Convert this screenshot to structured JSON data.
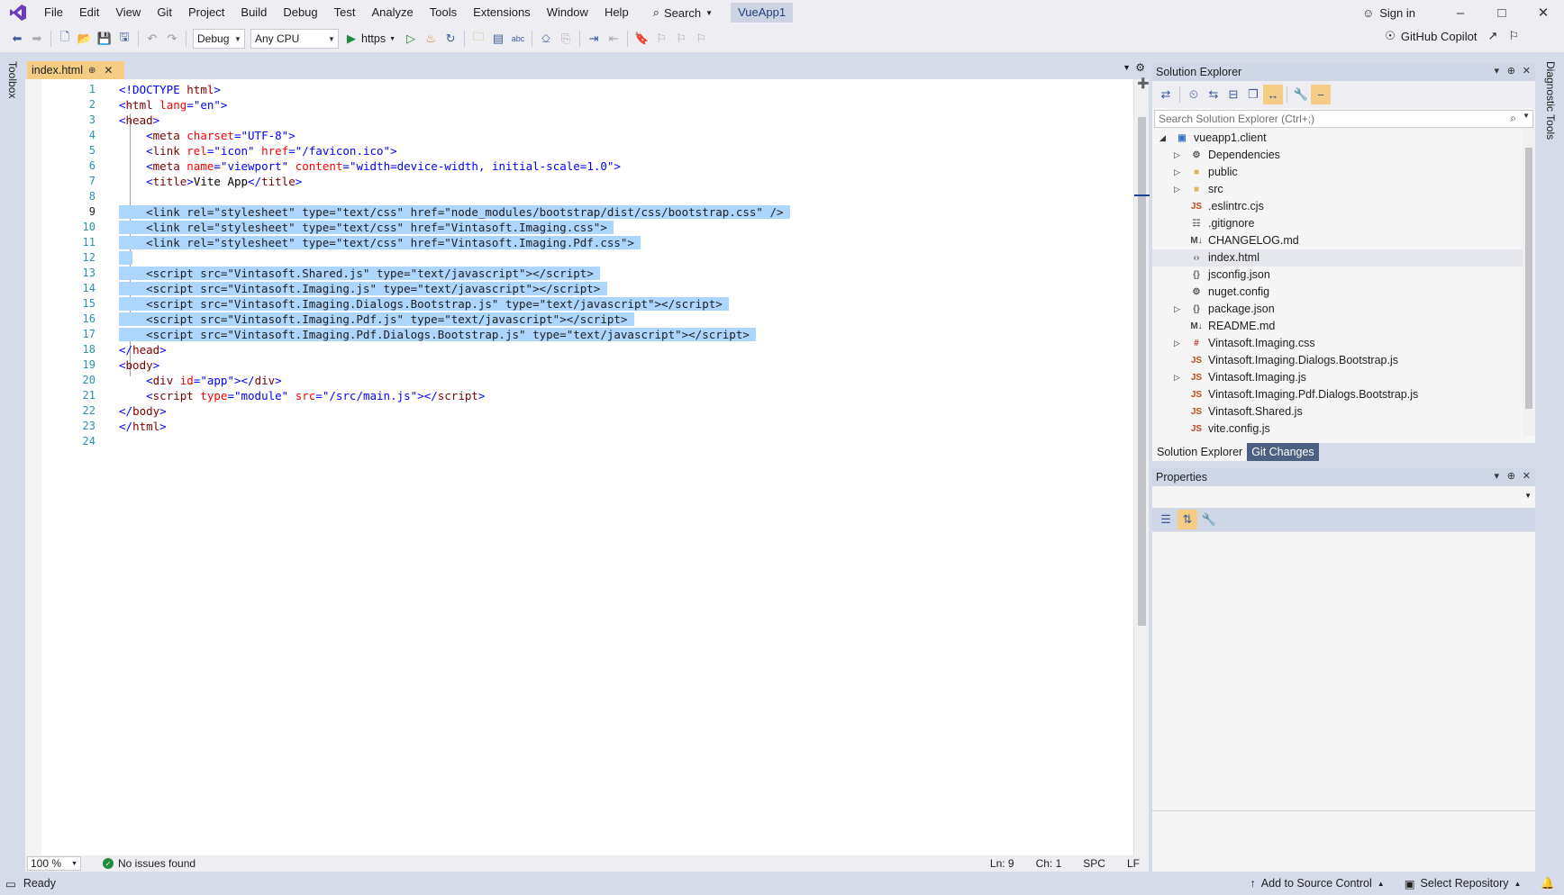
{
  "menubar": {
    "items": [
      "File",
      "Edit",
      "View",
      "Git",
      "Project",
      "Build",
      "Debug",
      "Test",
      "Analyze",
      "Tools",
      "Extensions",
      "Window",
      "Help"
    ],
    "search_label": "Search",
    "solution_name": "VueApp1",
    "sign_in": "Sign in"
  },
  "toolbar": {
    "config": "Debug",
    "platform": "Any CPU",
    "run_target": "https",
    "copilot": "GitHub Copilot"
  },
  "side": {
    "toolbox": "Toolbox",
    "diagnostic": "Diagnostic Tools"
  },
  "editor": {
    "tab_name": "index.html",
    "lines": [
      [
        [
          "d",
          "<!DOCTYPE "
        ],
        [
          "tag",
          "html"
        ],
        [
          "d",
          ">"
        ]
      ],
      [
        [
          "d",
          "<"
        ],
        [
          "tag",
          "html "
        ],
        [
          "a",
          "lang"
        ],
        [
          "d",
          "="
        ],
        [
          "v",
          "\"en\""
        ],
        [
          "d",
          ">"
        ]
      ],
      [
        [
          "d",
          "<"
        ],
        [
          "tag",
          "head"
        ],
        [
          "d",
          ">"
        ]
      ],
      [
        [
          "x",
          "    "
        ],
        [
          "d",
          "<"
        ],
        [
          "tag",
          "meta "
        ],
        [
          "a",
          "charset"
        ],
        [
          "d",
          "="
        ],
        [
          "v",
          "\"UTF-8\""
        ],
        [
          "d",
          ">"
        ]
      ],
      [
        [
          "x",
          "    "
        ],
        [
          "d",
          "<"
        ],
        [
          "tag",
          "link "
        ],
        [
          "a",
          "rel"
        ],
        [
          "d",
          "="
        ],
        [
          "v",
          "\"icon\" "
        ],
        [
          "a",
          "href"
        ],
        [
          "d",
          "="
        ],
        [
          "v",
          "\"/favicon.ico\""
        ],
        [
          "d",
          ">"
        ]
      ],
      [
        [
          "x",
          "    "
        ],
        [
          "d",
          "<"
        ],
        [
          "tag",
          "meta "
        ],
        [
          "a",
          "name"
        ],
        [
          "d",
          "="
        ],
        [
          "v",
          "\"viewport\" "
        ],
        [
          "a",
          "content"
        ],
        [
          "d",
          "="
        ],
        [
          "v",
          "\"width=device-width, initial-scale=1.0\""
        ],
        [
          "d",
          ">"
        ]
      ],
      [
        [
          "x",
          "    "
        ],
        [
          "d",
          "<"
        ],
        [
          "tag",
          "title"
        ],
        [
          "d",
          ">"
        ],
        [
          "x",
          "Vite App"
        ],
        [
          "d",
          "</"
        ],
        [
          "tag",
          "title"
        ],
        [
          "d",
          ">"
        ]
      ],
      [],
      [
        [
          "x",
          "    "
        ],
        [
          "d",
          "<"
        ],
        [
          "tag",
          "link "
        ],
        [
          "a",
          "rel"
        ],
        [
          "d",
          "="
        ],
        [
          "v",
          "\"stylesheet\" "
        ],
        [
          "a",
          "type"
        ],
        [
          "d",
          "="
        ],
        [
          "v",
          "\"text/css\" "
        ],
        [
          "a",
          "href"
        ],
        [
          "d",
          "="
        ],
        [
          "v",
          "\"node_modules/bootstrap/dist/css/bootstrap.css\" "
        ],
        [
          "d",
          "/>"
        ]
      ],
      [
        [
          "x",
          "    "
        ],
        [
          "d",
          "<"
        ],
        [
          "tag",
          "link "
        ],
        [
          "a",
          "rel"
        ],
        [
          "d",
          "="
        ],
        [
          "v",
          "\"stylesheet\" "
        ],
        [
          "a",
          "type"
        ],
        [
          "d",
          "="
        ],
        [
          "v",
          "\"text/css\" "
        ],
        [
          "a",
          "href"
        ],
        [
          "d",
          "="
        ],
        [
          "v",
          "\"Vintasoft.Imaging.css\""
        ],
        [
          "d",
          ">"
        ]
      ],
      [
        [
          "x",
          "    "
        ],
        [
          "d",
          "<"
        ],
        [
          "tag",
          "link "
        ],
        [
          "a",
          "rel"
        ],
        [
          "d",
          "="
        ],
        [
          "v",
          "\"stylesheet\" "
        ],
        [
          "a",
          "type"
        ],
        [
          "d",
          "="
        ],
        [
          "v",
          "\"text/css\" "
        ],
        [
          "a",
          "href"
        ],
        [
          "d",
          "="
        ],
        [
          "v",
          "\"Vintasoft.Imaging.Pdf.css\""
        ],
        [
          "d",
          ">"
        ]
      ],
      [],
      [
        [
          "x",
          "    "
        ],
        [
          "d",
          "<"
        ],
        [
          "tag",
          "script "
        ],
        [
          "a",
          "src"
        ],
        [
          "d",
          "="
        ],
        [
          "v",
          "\"Vintasoft.Shared.js\" "
        ],
        [
          "a",
          "type"
        ],
        [
          "d",
          "="
        ],
        [
          "v",
          "\"text/javascript\""
        ],
        [
          "d",
          "></"
        ],
        [
          "tag",
          "script"
        ],
        [
          "d",
          ">"
        ]
      ],
      [
        [
          "x",
          "    "
        ],
        [
          "d",
          "<"
        ],
        [
          "tag",
          "script "
        ],
        [
          "a",
          "src"
        ],
        [
          "d",
          "="
        ],
        [
          "v",
          "\"Vintasoft.Imaging.js\" "
        ],
        [
          "a",
          "type"
        ],
        [
          "d",
          "="
        ],
        [
          "v",
          "\"text/javascript\""
        ],
        [
          "d",
          "></"
        ],
        [
          "tag",
          "script"
        ],
        [
          "d",
          ">"
        ]
      ],
      [
        [
          "x",
          "    "
        ],
        [
          "d",
          "<"
        ],
        [
          "tag",
          "script "
        ],
        [
          "a",
          "src"
        ],
        [
          "d",
          "="
        ],
        [
          "v",
          "\"Vintasoft.Imaging.Dialogs.Bootstrap.js\" "
        ],
        [
          "a",
          "type"
        ],
        [
          "d",
          "="
        ],
        [
          "v",
          "\"text/javascript\""
        ],
        [
          "d",
          "></"
        ],
        [
          "tag",
          "script"
        ],
        [
          "d",
          ">"
        ]
      ],
      [
        [
          "x",
          "    "
        ],
        [
          "d",
          "<"
        ],
        [
          "tag",
          "script "
        ],
        [
          "a",
          "src"
        ],
        [
          "d",
          "="
        ],
        [
          "v",
          "\"Vintasoft.Imaging.Pdf.js\" "
        ],
        [
          "a",
          "type"
        ],
        [
          "d",
          "="
        ],
        [
          "v",
          "\"text/javascript\""
        ],
        [
          "d",
          "></"
        ],
        [
          "tag",
          "script"
        ],
        [
          "d",
          ">"
        ]
      ],
      [
        [
          "x",
          "    "
        ],
        [
          "d",
          "<"
        ],
        [
          "tag",
          "script "
        ],
        [
          "a",
          "src"
        ],
        [
          "d",
          "="
        ],
        [
          "v",
          "\"Vintasoft.Imaging.Pdf.Dialogs.Bootstrap.js\" "
        ],
        [
          "a",
          "type"
        ],
        [
          "d",
          "="
        ],
        [
          "v",
          "\"text/javascript\""
        ],
        [
          "d",
          "></"
        ],
        [
          "tag",
          "script"
        ],
        [
          "d",
          ">"
        ]
      ],
      [
        [
          "d",
          "</"
        ],
        [
          "tag",
          "head"
        ],
        [
          "d",
          ">"
        ]
      ],
      [
        [
          "d",
          "<"
        ],
        [
          "tag",
          "body"
        ],
        [
          "d",
          ">"
        ]
      ],
      [
        [
          "x",
          "    "
        ],
        [
          "d",
          "<"
        ],
        [
          "tag",
          "div "
        ],
        [
          "a",
          "id"
        ],
        [
          "d",
          "="
        ],
        [
          "v",
          "\"app\""
        ],
        [
          "d",
          "></"
        ],
        [
          "tag",
          "div"
        ],
        [
          "d",
          ">"
        ]
      ],
      [
        [
          "x",
          "    "
        ],
        [
          "d",
          "<"
        ],
        [
          "tag",
          "script "
        ],
        [
          "a",
          "type"
        ],
        [
          "d",
          "="
        ],
        [
          "v",
          "\"module\" "
        ],
        [
          "a",
          "src"
        ],
        [
          "d",
          "="
        ],
        [
          "v",
          "\"/src/main.js\""
        ],
        [
          "d",
          "></"
        ],
        [
          "tag",
          "script"
        ],
        [
          "d",
          ">"
        ]
      ],
      [
        [
          "d",
          "</"
        ],
        [
          "tag",
          "body"
        ],
        [
          "d",
          ">"
        ]
      ],
      [
        [
          "d",
          "</"
        ],
        [
          "tag",
          "html"
        ],
        [
          "d",
          ">"
        ]
      ],
      []
    ],
    "selected_lines": [
      9,
      10,
      11,
      12,
      13,
      14,
      15,
      16,
      17
    ],
    "current_line": 9,
    "fold_lines": [
      2,
      3,
      19
    ],
    "zoom": "100 %",
    "issues": "No issues found",
    "ln": "Ln: 9",
    "ch": "Ch: 1",
    "spc": "SPC",
    "eol": "LF"
  },
  "solution_explorer": {
    "title": "Solution Explorer",
    "search_placeholder": "Search Solution Explorer (Ctrl+;)",
    "items": [
      {
        "label": "vueapp1.client",
        "level": 0,
        "expander": "open",
        "icon": "project-icon"
      },
      {
        "label": "Dependencies",
        "level": 1,
        "expander": "closed",
        "icon": "dependencies-icon"
      },
      {
        "label": "public",
        "level": 1,
        "expander": "closed",
        "icon": "folder-icon"
      },
      {
        "label": "src",
        "level": 1,
        "expander": "closed",
        "icon": "folder-icon"
      },
      {
        "label": ".eslintrc.cjs",
        "level": 1,
        "expander": "",
        "icon": "js-icon"
      },
      {
        "label": ".gitignore",
        "level": 1,
        "expander": "",
        "icon": "file-icon"
      },
      {
        "label": "CHANGELOG.md",
        "level": 1,
        "expander": "",
        "icon": "md-icon"
      },
      {
        "label": "index.html",
        "level": 1,
        "expander": "",
        "icon": "html-icon",
        "selected": true
      },
      {
        "label": "jsconfig.json",
        "level": 1,
        "expander": "",
        "icon": "json-icon"
      },
      {
        "label": "nuget.config",
        "level": 1,
        "expander": "",
        "icon": "config-icon"
      },
      {
        "label": "package.json",
        "level": 1,
        "expander": "closed",
        "icon": "json-icon"
      },
      {
        "label": "README.md",
        "level": 1,
        "expander": "",
        "icon": "md-icon"
      },
      {
        "label": "Vintasoft.Imaging.css",
        "level": 1,
        "expander": "closed",
        "icon": "css-icon"
      },
      {
        "label": "Vintasoft.Imaging.Dialogs.Bootstrap.js",
        "level": 1,
        "expander": "",
        "icon": "js-icon"
      },
      {
        "label": "Vintasoft.Imaging.js",
        "level": 1,
        "expander": "closed",
        "icon": "js-icon"
      },
      {
        "label": "Vintasoft.Imaging.Pdf.Dialogs.Bootstrap.js",
        "level": 1,
        "expander": "",
        "icon": "js-icon"
      },
      {
        "label": "Vintasoft.Shared.js",
        "level": 1,
        "expander": "",
        "icon": "js-icon"
      },
      {
        "label": "vite.config.js",
        "level": 1,
        "expander": "",
        "icon": "js-icon"
      }
    ],
    "tabs": [
      "Solution Explorer",
      "Git Changes"
    ]
  },
  "properties": {
    "title": "Properties"
  },
  "statusbar": {
    "ready": "Ready",
    "source_control": "Add to Source Control",
    "repository": "Select Repository"
  }
}
